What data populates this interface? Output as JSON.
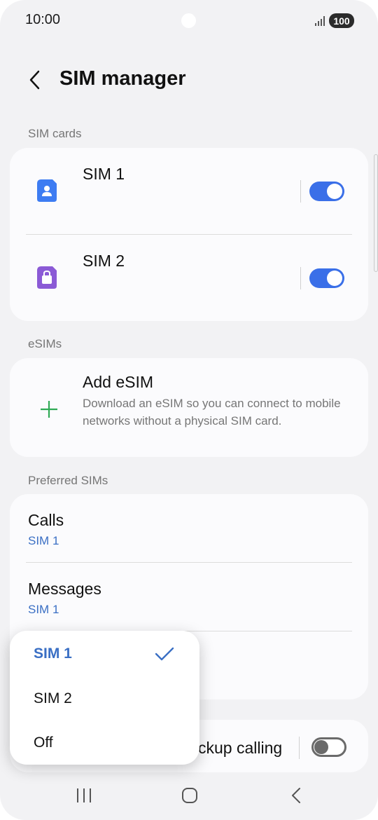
{
  "status_bar": {
    "time": "10:00",
    "battery": "100"
  },
  "header": {
    "title": "SIM manager"
  },
  "sim_cards": {
    "label": "SIM cards",
    "items": [
      {
        "name": "SIM 1",
        "enabled": true,
        "icon": "sim-person-icon",
        "color": "#3d7cf2"
      },
      {
        "name": "SIM 2",
        "enabled": true,
        "icon": "sim-bag-icon",
        "color": "#8b5ad6"
      }
    ]
  },
  "esims": {
    "label": "eSIMs",
    "add_title": "Add eSIM",
    "add_desc": "Download an eSIM so you can connect to mobile networks without a physical SIM card."
  },
  "preferred": {
    "label": "Preferred SIMs",
    "calls": {
      "title": "Calls",
      "value": "SIM 1"
    },
    "messages": {
      "title": "Messages",
      "value": "SIM 1"
    }
  },
  "backup_calling": {
    "title_partial": "ckup calling",
    "enabled": false
  },
  "popup": {
    "options": [
      "SIM 1",
      "SIM 2",
      "Off"
    ],
    "selected": "SIM 1"
  },
  "colors": {
    "accent": "#3a6fe8",
    "link": "#3a6fc4",
    "add_icon": "#2faa55"
  }
}
